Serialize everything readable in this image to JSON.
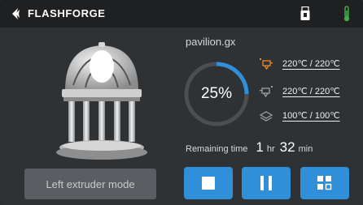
{
  "header": {
    "brand": "FLASHFORGE",
    "icons": [
      "flashforge-logo-icon",
      "usb-icon",
      "thermometer-icon"
    ]
  },
  "print": {
    "filename": "pavilion.gx",
    "progress_text": "25%",
    "progress": 0.25,
    "remaining_label": "Remaining time",
    "remaining_hr": "1",
    "hr_unit": "hr",
    "remaining_min": "32",
    "min_unit": "min"
  },
  "temps": {
    "left_extruder": "220℃ / 220℃",
    "right_extruder": "220℃ / 220℃",
    "bed": "100℃ / 100℃"
  },
  "buttons": {
    "mode": "Left extruder mode",
    "stop": "stop-icon",
    "pause": "pause-icon",
    "more": "more-grid-icon"
  },
  "colors": {
    "accent": "#2f8fd8",
    "extruder_icon": "#e8892a",
    "thermometer": "#3fae4a"
  }
}
